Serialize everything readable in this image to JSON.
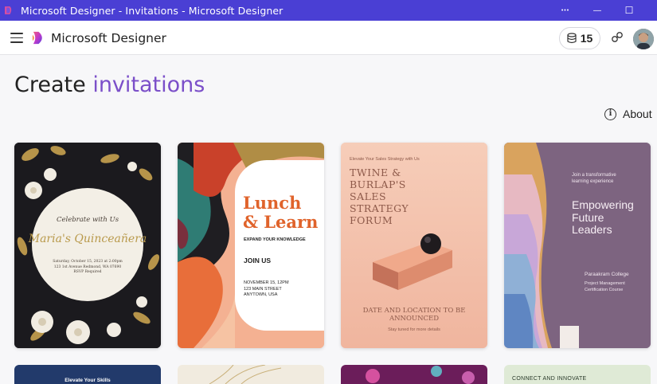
{
  "window": {
    "title": "Microsoft Designer - Invitations - Microsoft Designer",
    "more_glyph": "•••",
    "minimize_glyph": "—",
    "maximize_glyph": "☐"
  },
  "header": {
    "brand": "Microsoft Designer",
    "credits": "15"
  },
  "page": {
    "title_prefix": "Create",
    "title_accent": "invitations",
    "about_label": "About",
    "about_glyph": "i"
  },
  "cards": [
    {
      "celebrate": "Celebrate with Us",
      "name": "Maria's Quinceañera",
      "details_line1": "Saturday, October 15, 2023 at 2:00pm",
      "details_line2": "123 1st Avenue Redmond, WA 07690",
      "details_line3": "RSVP Required"
    },
    {
      "headline_line1": "Lunch",
      "headline_line2": "& Learn",
      "subtitle": "EXPAND YOUR KNOWLEDGE",
      "cta": "JOIN US",
      "date_line1": "NOVEMBER 15, 12PM",
      "date_line2": "123 MAIN STREET",
      "date_line3": "ANYTOWN, USA"
    },
    {
      "kicker": "Elevate Your Sales Strategy with Us",
      "title_line1": "TWINE &",
      "title_line2": "BURLAP'S",
      "title_line3": "SALES",
      "title_line4": "STRATEGY",
      "title_line5": "FORUM",
      "footer_line1": "DATE AND LOCATION TO BE",
      "footer_line2": "ANNOUNCED",
      "note": "Stay tuned for more details"
    },
    {
      "kicker_line1": "Join a transformative",
      "kicker_line2": "learning experience",
      "title_line1": "Empowering",
      "title_line2": "Future",
      "title_line3": "Leaders",
      "college": "Paraakram College",
      "course_line1": "Project Management",
      "course_line2": "Certification Course"
    }
  ],
  "bottom_cards": {
    "first_text": "Elevate Your Skills",
    "last_text": "CONNECT AND INNOVATE"
  },
  "colors": {
    "titlebar": "#4a3fd4",
    "accent": "#7b4fc9",
    "lunch_orange": "#e0632b"
  }
}
